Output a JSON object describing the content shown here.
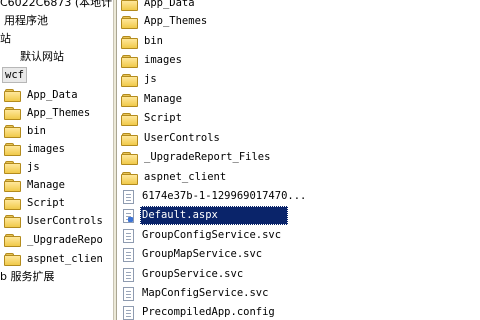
{
  "tree": {
    "server_label": "C6022C6873 (本地计",
    "app_pools_label": "用程序池",
    "sites_label": "站",
    "default_site_label": "默认网站",
    "wcf_label": "wcf",
    "children": [
      {
        "label": "App_Data"
      },
      {
        "label": "App_Themes"
      },
      {
        "label": "bin"
      },
      {
        "label": "images"
      },
      {
        "label": "js"
      },
      {
        "label": "Manage"
      },
      {
        "label": "Script"
      },
      {
        "label": "UserControls"
      },
      {
        "label": "_UpgradeRepo"
      },
      {
        "label": "aspnet_clien"
      }
    ],
    "service_ext_label": "b 服务扩展"
  },
  "file_list": {
    "items": [
      {
        "label": "App_Data",
        "type": "folder"
      },
      {
        "label": "App_Themes",
        "type": "folder"
      },
      {
        "label": "bin",
        "type": "folder"
      },
      {
        "label": "images",
        "type": "folder"
      },
      {
        "label": "js",
        "type": "folder"
      },
      {
        "label": "Manage",
        "type": "folder"
      },
      {
        "label": "Script",
        "type": "folder"
      },
      {
        "label": "UserControls",
        "type": "folder"
      },
      {
        "label": "_UpgradeReport_Files",
        "type": "folder"
      },
      {
        "label": "aspnet_client",
        "type": "folder"
      },
      {
        "label": "6174e37b-1-129969017470...",
        "type": "file"
      },
      {
        "label": "Default.aspx",
        "type": "aspx",
        "selected": true
      },
      {
        "label": "GroupConfigService.svc",
        "type": "file"
      },
      {
        "label": "GroupMapService.svc",
        "type": "file"
      },
      {
        "label": "GroupService.svc",
        "type": "file"
      },
      {
        "label": "MapConfigService.svc",
        "type": "file"
      },
      {
        "label": "PrecompiledApp.config",
        "type": "file"
      }
    ]
  }
}
